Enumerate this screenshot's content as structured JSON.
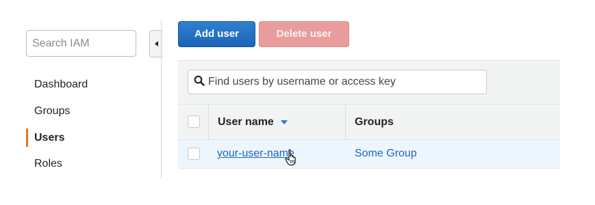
{
  "sidebar": {
    "search": {
      "placeholder": "Search IAM"
    },
    "items": [
      {
        "label": "Dashboard"
      },
      {
        "label": "Groups"
      },
      {
        "label": "Users",
        "active": true
      },
      {
        "label": "Roles"
      }
    ],
    "active_color": "#ec7211"
  },
  "toolbar": {
    "add_label": "Add user",
    "delete_label": "Delete user"
  },
  "filter": {
    "placeholder": "Find users by username or access key"
  },
  "table": {
    "columns": [
      "User name",
      "Groups"
    ],
    "rows": [
      {
        "username": "your-user-name",
        "groups": "Some Group"
      }
    ]
  },
  "colors": {
    "primary_button": "#1c64b9",
    "disabled_danger_button": "#e99c9c",
    "link": "#1b64c0",
    "row_highlight": "#eef6fd"
  }
}
